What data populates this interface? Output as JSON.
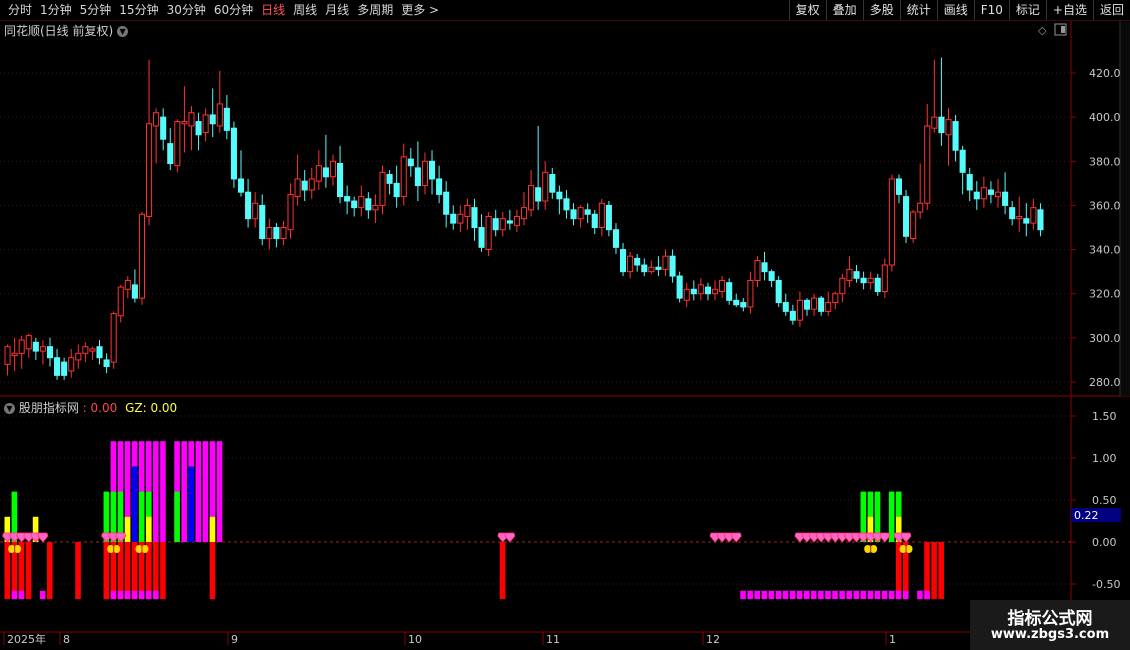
{
  "toolbar": {
    "timeframes": [
      "分时",
      "1分钟",
      "5分钟",
      "15分钟",
      "30分钟",
      "60分钟",
      "日线",
      "周线",
      "月线",
      "多周期",
      "更多 >"
    ],
    "active": "日线",
    "tools": [
      "复权",
      "叠加",
      "多股",
      "统计",
      "画线",
      "F10",
      "标记",
      "+自选",
      "返回"
    ]
  },
  "main_title": "同花顺(日线 前复权)",
  "indicator": {
    "name": "股朋指标网",
    "val1": ": 0.00",
    "label2": "GZ: 0.00"
  },
  "price_axis": [
    "420.0",
    "400.0",
    "380.0",
    "360.0",
    "340.0",
    "320.0",
    "300.0",
    "280.0"
  ],
  "ind_axis": [
    "1.50",
    "1.00",
    "0.50",
    "0.00",
    "-0.50"
  ],
  "ind_value_box": "0.22",
  "date_axis": [
    "2025年",
    "8",
    "9",
    "10",
    "11",
    "12",
    "1"
  ],
  "watermark": {
    "line1": "指标公式网",
    "line2": "www.zbgs3.com"
  },
  "colors": {
    "up": "#ff3232",
    "down": "#54fcfc",
    "magenta": "#ff00ff",
    "green": "#00ff00",
    "yellow": "#ffff00",
    "blue": "#0000ff",
    "red": "#ff0000",
    "pink": "#ff66cc"
  },
  "chart_data": {
    "type": "candlestick",
    "ylim": [
      275,
      435
    ],
    "candles": [
      [
        288,
        296,
        284,
        283,
        297
      ],
      [
        292,
        293,
        286,
        285,
        300
      ],
      [
        293,
        299,
        289,
        286,
        301
      ],
      [
        295,
        301,
        292,
        291,
        302
      ],
      [
        298,
        294,
        292,
        290,
        300
      ],
      [
        294,
        296,
        290,
        288,
        299
      ],
      [
        296,
        291,
        288,
        287,
        300
      ],
      [
        291,
        283,
        282,
        281,
        295
      ],
      [
        289,
        283,
        282,
        281,
        291
      ],
      [
        285,
        291,
        283,
        282,
        295
      ],
      [
        290,
        293,
        287,
        286,
        297
      ],
      [
        293,
        296,
        291,
        289,
        298
      ],
      [
        294,
        295,
        291,
        290,
        296
      ],
      [
        296,
        291,
        289,
        288,
        299
      ],
      [
        290,
        287,
        285,
        284,
        293
      ],
      [
        289,
        311,
        287,
        286,
        312
      ],
      [
        310,
        323,
        309,
        307,
        324
      ],
      [
        322,
        326,
        320,
        318,
        328
      ],
      [
        324,
        318,
        316,
        316,
        331
      ],
      [
        318,
        356,
        316,
        315,
        357
      ],
      [
        355,
        397,
        353,
        351,
        426
      ],
      [
        396,
        402,
        390,
        379,
        404
      ],
      [
        400,
        390,
        386,
        385,
        404
      ],
      [
        388,
        379,
        377,
        376,
        395
      ],
      [
        378,
        398,
        376,
        375,
        399
      ],
      [
        397,
        398,
        388,
        384,
        414
      ],
      [
        396,
        402,
        393,
        385,
        405
      ],
      [
        398,
        392,
        389,
        385,
        402
      ],
      [
        393,
        401,
        391,
        389,
        404
      ],
      [
        401,
        397,
        395,
        391,
        413
      ],
      [
        396,
        406,
        394,
        393,
        421
      ],
      [
        404,
        394,
        392,
        390,
        410
      ],
      [
        395,
        372,
        370,
        368,
        398
      ],
      [
        372,
        366,
        365,
        364,
        385
      ],
      [
        366,
        354,
        352,
        350,
        372
      ],
      [
        354,
        361,
        352,
        350,
        366
      ],
      [
        360,
        345,
        343,
        342,
        365
      ],
      [
        345,
        350,
        344,
        340,
        354
      ],
      [
        350,
        345,
        342,
        341,
        352
      ],
      [
        345,
        350,
        344,
        342,
        353
      ],
      [
        349,
        365,
        347,
        345,
        370
      ],
      [
        364,
        372,
        362,
        360,
        383
      ],
      [
        371,
        367,
        364,
        362,
        376
      ],
      [
        367,
        372,
        365,
        363,
        377
      ],
      [
        371,
        378,
        369,
        367,
        385
      ],
      [
        377,
        373,
        370,
        368,
        392
      ],
      [
        373,
        380,
        371,
        369,
        383
      ],
      [
        379,
        364,
        363,
        361,
        387
      ],
      [
        364,
        362,
        360,
        356,
        369
      ],
      [
        362,
        359,
        357,
        355,
        364
      ],
      [
        359,
        364,
        357,
        355,
        369
      ],
      [
        363,
        358,
        355,
        354,
        366
      ],
      [
        358,
        360,
        352,
        352,
        365
      ],
      [
        360,
        375,
        358,
        356,
        378
      ],
      [
        374,
        370,
        366,
        365,
        376
      ],
      [
        370,
        364,
        362,
        359,
        378
      ],
      [
        364,
        382,
        362,
        360,
        388
      ],
      [
        381,
        378,
        376,
        373,
        386
      ],
      [
        377,
        369,
        365,
        362,
        389
      ],
      [
        369,
        380,
        367,
        365,
        384
      ],
      [
        380,
        372,
        368,
        365,
        385
      ],
      [
        372,
        365,
        364,
        361,
        378
      ],
      [
        366,
        356,
        352,
        350,
        371
      ],
      [
        356,
        352,
        351,
        349,
        360
      ],
      [
        352,
        356,
        349,
        348,
        360
      ],
      [
        355,
        360,
        352,
        349,
        363
      ],
      [
        359,
        350,
        348,
        344,
        363
      ],
      [
        350,
        341,
        340,
        339,
        356
      ],
      [
        340,
        355,
        338,
        337,
        357
      ],
      [
        354,
        349,
        347,
        346,
        358
      ],
      [
        349,
        354,
        348,
        346,
        357
      ],
      [
        353,
        352,
        350,
        349,
        358
      ],
      [
        351,
        355,
        349,
        348,
        358
      ],
      [
        354,
        359,
        352,
        351,
        366
      ],
      [
        358,
        369,
        356,
        355,
        376
      ],
      [
        368,
        362,
        360,
        358,
        396
      ],
      [
        362,
        375,
        359,
        358,
        380
      ],
      [
        374,
        366,
        364,
        363,
        377
      ],
      [
        366,
        363,
        360,
        356,
        369
      ],
      [
        363,
        358,
        355,
        354,
        367
      ],
      [
        358,
        354,
        352,
        351,
        361
      ],
      [
        354,
        359,
        352,
        350,
        360
      ],
      [
        358,
        356,
        354,
        352,
        361
      ],
      [
        356,
        350,
        348,
        347,
        358
      ],
      [
        350,
        361,
        348,
        346,
        363
      ],
      [
        360,
        349,
        347,
        346,
        362
      ],
      [
        349,
        341,
        339,
        338,
        352
      ],
      [
        340,
        330,
        329,
        328,
        343
      ],
      [
        330,
        337,
        328,
        327,
        339
      ],
      [
        336,
        333,
        331,
        330,
        338
      ],
      [
        333,
        330,
        329,
        328,
        336
      ],
      [
        330,
        332,
        329,
        329,
        335
      ],
      [
        332,
        331,
        329,
        328,
        337
      ],
      [
        331,
        337,
        329,
        328,
        340
      ],
      [
        337,
        328,
        326,
        325,
        340
      ],
      [
        328,
        318,
        317,
        316,
        330
      ],
      [
        317,
        322,
        315,
        314,
        325
      ],
      [
        322,
        320,
        318,
        317,
        326
      ],
      [
        320,
        324,
        318,
        317,
        327
      ],
      [
        323,
        320,
        318,
        317,
        325
      ],
      [
        320,
        322,
        318,
        317,
        326
      ],
      [
        321,
        326,
        319,
        318,
        328
      ],
      [
        325,
        317,
        316,
        315,
        327
      ],
      [
        317,
        315,
        314,
        314,
        320
      ],
      [
        316,
        314,
        313,
        312,
        318
      ],
      [
        314,
        326,
        312,
        311,
        330
      ],
      [
        326,
        335,
        324,
        323,
        337
      ],
      [
        334,
        330,
        328,
        326,
        339
      ],
      [
        330,
        326,
        324,
        323,
        331
      ],
      [
        326,
        316,
        315,
        314,
        328
      ],
      [
        316,
        312,
        311,
        310,
        320
      ],
      [
        312,
        308,
        307,
        306,
        315
      ],
      [
        308,
        317,
        306,
        305,
        321
      ],
      [
        317,
        313,
        311,
        310,
        318
      ],
      [
        313,
        318,
        312,
        310,
        320
      ],
      [
        318,
        312,
        311,
        310,
        319
      ],
      [
        312,
        316,
        311,
        310,
        321
      ],
      [
        316,
        320,
        315,
        313,
        321
      ],
      [
        320,
        327,
        318,
        316,
        329
      ],
      [
        326,
        331,
        325,
        323,
        337
      ],
      [
        330,
        327,
        326,
        325,
        333
      ],
      [
        327,
        325,
        324,
        322,
        330
      ],
      [
        325,
        327,
        323,
        322,
        330
      ],
      [
        327,
        321,
        320,
        319,
        329
      ],
      [
        321,
        333,
        319,
        318,
        336
      ],
      [
        333,
        372,
        331,
        330,
        374
      ],
      [
        372,
        365,
        362,
        361,
        374
      ],
      [
        364,
        346,
        344,
        343,
        367
      ],
      [
        345,
        357,
        344,
        343,
        358
      ],
      [
        357,
        361,
        355,
        354,
        379
      ],
      [
        361,
        396,
        359,
        358,
        406
      ],
      [
        395,
        400,
        397,
        393,
        426
      ],
      [
        400,
        393,
        390,
        387,
        427
      ],
      [
        392,
        399,
        390,
        378,
        404
      ],
      [
        398,
        385,
        383,
        380,
        401
      ],
      [
        385,
        375,
        373,
        365,
        387
      ],
      [
        374,
        367,
        364,
        362,
        377
      ],
      [
        366,
        363,
        361,
        358,
        371
      ],
      [
        363,
        368,
        361,
        359,
        373
      ],
      [
        367,
        365,
        362,
        361,
        371
      ],
      [
        364,
        366,
        362,
        359,
        372
      ],
      [
        366,
        360,
        358,
        356,
        375
      ],
      [
        359,
        354,
        352,
        351,
        362
      ],
      [
        354,
        355,
        350,
        348,
        364
      ],
      [
        354,
        352,
        348,
        346,
        361
      ],
      [
        352,
        359,
        350,
        349,
        363
      ],
      [
        358,
        349,
        347,
        346,
        361
      ]
    ]
  }
}
